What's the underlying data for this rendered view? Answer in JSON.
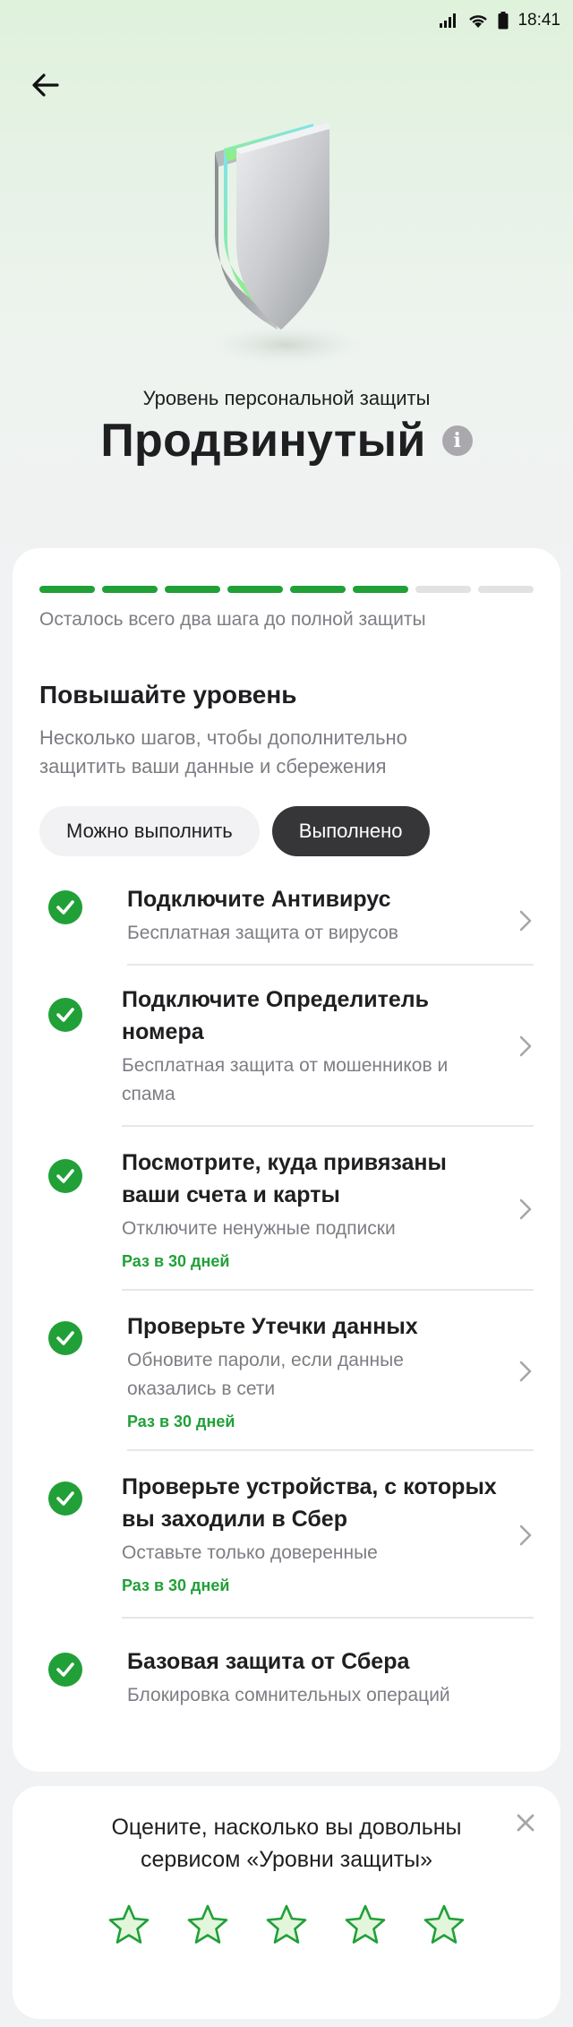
{
  "status_bar": {
    "time": "18:41"
  },
  "header": {
    "caption": "Уровень персональной защиты",
    "title": "Продвинутый",
    "info_glyph": "i"
  },
  "progress": {
    "steps_total": 8,
    "steps_done": 6,
    "caption": "Осталось всего два шага до полной защиты",
    "color_done": "#21a038",
    "color_todo": "#e2e2e5"
  },
  "section": {
    "title": "Повышайте уровень",
    "subtitle": "Несколько шагов, чтобы дополнительно защитить ваши данные и сбережения"
  },
  "filters": [
    {
      "label": "Можно выполнить",
      "active": false
    },
    {
      "label": "Выполнено",
      "active": true
    }
  ],
  "tasks": [
    {
      "title": "Подключите Антивирус",
      "subtitle": "Бесплатная защита от вирусов",
      "period": "",
      "has_chevron": true
    },
    {
      "title": "Подключите Определитель номера",
      "subtitle": "Бесплатная защита от мошенников и спама",
      "period": "",
      "has_chevron": true
    },
    {
      "title": "Посмотрите, куда привязаны ваши счета и карты",
      "subtitle": "Отключите ненужные подписки",
      "period": "Раз в 30 дней",
      "has_chevron": true
    },
    {
      "title": "Проверьте Утечки данных",
      "subtitle": "Обновите пароли, если данные оказались в сети",
      "period": "Раз в 30 дней",
      "has_chevron": true
    },
    {
      "title": "Проверьте устройства, с которых вы заходили в Сбер",
      "subtitle": "Оставьте только доверенные",
      "period": "Раз в 30 дней",
      "has_chevron": true
    },
    {
      "title": "Базовая защита от Сбера",
      "subtitle": "Блокировка сомнительных операций",
      "period": "",
      "has_chevron": false
    }
  ],
  "rating": {
    "text": "Оцените, насколько вы довольны сервисом «Уровни защиты»",
    "stars": 5,
    "star_color": "#21a038"
  },
  "colors": {
    "accent": "#21a038",
    "dark_chip": "#363638"
  }
}
